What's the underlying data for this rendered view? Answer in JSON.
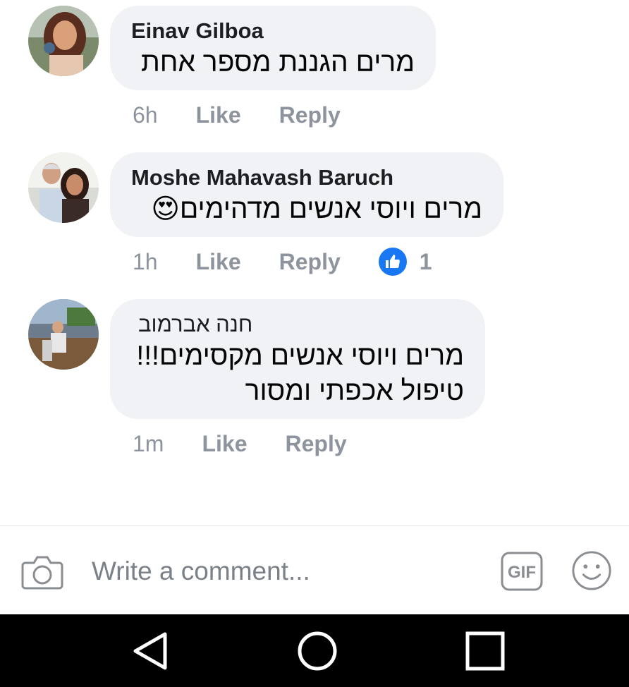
{
  "comments": [
    {
      "author": "Einav Gilboa",
      "lines": [
        "מרים הגננת מספר אחת"
      ],
      "time": "6h",
      "like_label": "Like",
      "reply_label": "Reply"
    },
    {
      "author": "Moshe Mahavash Baruch",
      "lines": [
        "מרים ויוסי אנשים מדהימים😍"
      ],
      "time": "1h",
      "like_label": "Like",
      "reply_label": "Reply",
      "reaction_count": "1",
      "reaction_icon": "thumbs-up-icon"
    },
    {
      "author": "חנה אברמוב",
      "lines": [
        "מרים ויוסי אנשים מקסימים!!!",
        "טיפול אכפתי ומסור"
      ],
      "time": "1m",
      "like_label": "Like",
      "reply_label": "Reply"
    }
  ],
  "composer": {
    "placeholder": "Write a comment...",
    "camera_icon": "camera-icon",
    "gif_label": "GIF",
    "emoji_icon": "smiley-icon"
  },
  "navbar": {
    "back_icon": "back-triangle-icon",
    "home_icon": "home-circle-icon",
    "recents_icon": "recents-square-icon"
  },
  "colors": {
    "bubble": "#f0f2f5",
    "meta_text": "#8d949e",
    "like_badge": "#1877f2"
  }
}
